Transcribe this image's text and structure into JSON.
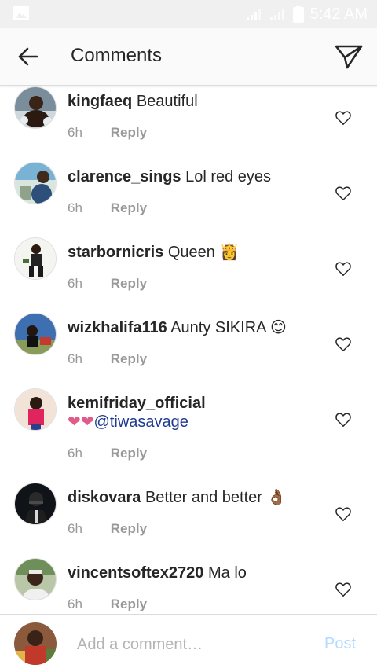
{
  "status_bar": {
    "time": "5:42 AM"
  },
  "header": {
    "title": "Comments"
  },
  "comments": [
    {
      "username": "kingfaeq",
      "text": "Beautiful",
      "emoji": "",
      "time": "6h",
      "reply": "Reply"
    },
    {
      "username": "clarence_sings",
      "text": "Lol red eyes",
      "emoji": "",
      "time": "6h",
      "reply": "Reply"
    },
    {
      "username": "starbornicris",
      "text": "Queen",
      "emoji": "👸",
      "time": "6h",
      "reply": "Reply"
    },
    {
      "username": "wizkhalifa116",
      "text": "Aunty SIKIRA",
      "emoji": "😊",
      "time": "6h",
      "reply": "Reply"
    },
    {
      "username": "kemifriday_official",
      "hearts": "❤❤",
      "mention": "@tiwasavage",
      "time": "6h",
      "reply": "Reply"
    },
    {
      "username": "diskovara",
      "text": "Better and better",
      "emoji": "👌🏾",
      "time": "6h",
      "reply": "Reply"
    },
    {
      "username": "vincentsoftex2720",
      "text": "Ma lo",
      "emoji": "",
      "time": "6h",
      "reply": "Reply"
    }
  ],
  "composer": {
    "placeholder": "Add a comment…",
    "post_label": "Post"
  },
  "colors": {
    "accent_disabled": "#b3dbff",
    "mention": "#1f3a93",
    "secondary_text": "#999999"
  }
}
